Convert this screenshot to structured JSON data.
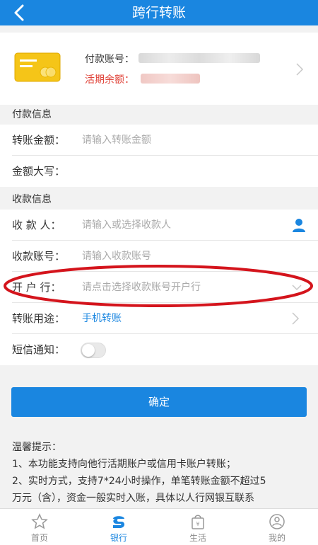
{
  "header": {
    "title": "跨行转账",
    "back_icon": "chevron-left-icon"
  },
  "account": {
    "account_no_label": "付款账号：",
    "balance_label": "活期余额：",
    "card_icon": "bank-card-icon"
  },
  "payment_section": {
    "title": "付款信息",
    "amount_label": "转账金额：",
    "amount_placeholder": "请输入转账金额",
    "amount_words_label": "金额大写："
  },
  "receive_section": {
    "title": "收款信息",
    "payee_label": "收 款 人：",
    "payee_placeholder": "请输入或选择收款人",
    "payee_icon": "contact-person-icon",
    "account_label": "收款账号：",
    "account_placeholder": "请输入收款账号",
    "bank_label": "开 户 行：",
    "bank_placeholder": "请点击选择收款账号开户行",
    "purpose_label": "转账用途：",
    "purpose_value": "手机转账",
    "sms_label": "短信通知：",
    "sms_enabled": false
  },
  "confirm_button": "确定",
  "tips": {
    "title": "温馨提示：",
    "line1": "1、本功能支持向他行活期账户或信用卡账户转账；",
    "line2": "2、实时方式，支持7*24小时操作，单笔转账金额不超过5",
    "line3": "万元（含），资金一般实时入账，具体以人行网银互联系"
  },
  "tabbar": {
    "tabs": [
      {
        "label": "首页",
        "icon": "star-icon",
        "active": false
      },
      {
        "label": "银行",
        "icon": "bank-logo-icon",
        "active": true
      },
      {
        "label": "生活",
        "icon": "shopping-bag-icon",
        "active": false
      },
      {
        "label": "我的",
        "icon": "user-icon",
        "active": false
      }
    ]
  },
  "colors": {
    "accent": "#1a86e0",
    "balance_red": "#e0443a",
    "highlight_red": "#d4141c"
  }
}
